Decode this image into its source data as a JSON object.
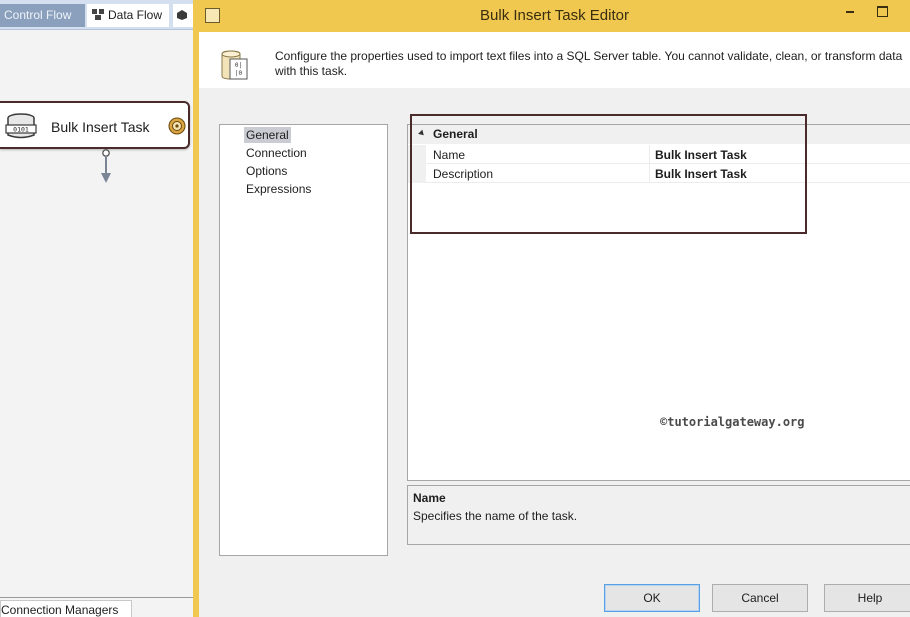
{
  "designer": {
    "tabs": [
      {
        "label": "Control Flow",
        "active": false
      },
      {
        "label": "Data Flow",
        "active": true
      }
    ],
    "task_node": {
      "label": "Bulk Insert Task",
      "icon": "database-icon",
      "status_icon": "warning-icon"
    },
    "connection_managers_tab": "Connection Managers"
  },
  "dialog": {
    "title": "Bulk Insert Task Editor",
    "description": "Configure the properties used to import text files into a SQL Server table. You cannot validate, clean, or transform data with this task.",
    "nav": {
      "items": [
        "General",
        "Connection",
        "Options",
        "Expressions"
      ],
      "selected": "General"
    },
    "grid": {
      "category": "General",
      "rows": [
        {
          "name": "Name",
          "value": "Bulk Insert Task"
        },
        {
          "name": "Description",
          "value": "Bulk Insert Task"
        }
      ]
    },
    "watermark": "©tutorialgateway.org",
    "help": {
      "title": "Name",
      "text": "Specifies the name of the task."
    },
    "buttons": {
      "ok": "OK",
      "cancel": "Cancel",
      "help": "Help"
    }
  },
  "colors": {
    "titlebar": "#f0c84f",
    "highlight_box": "#4a2a2a",
    "nav_selected": "#c9cdd3",
    "tab_inactive": "#8aa0bc"
  }
}
